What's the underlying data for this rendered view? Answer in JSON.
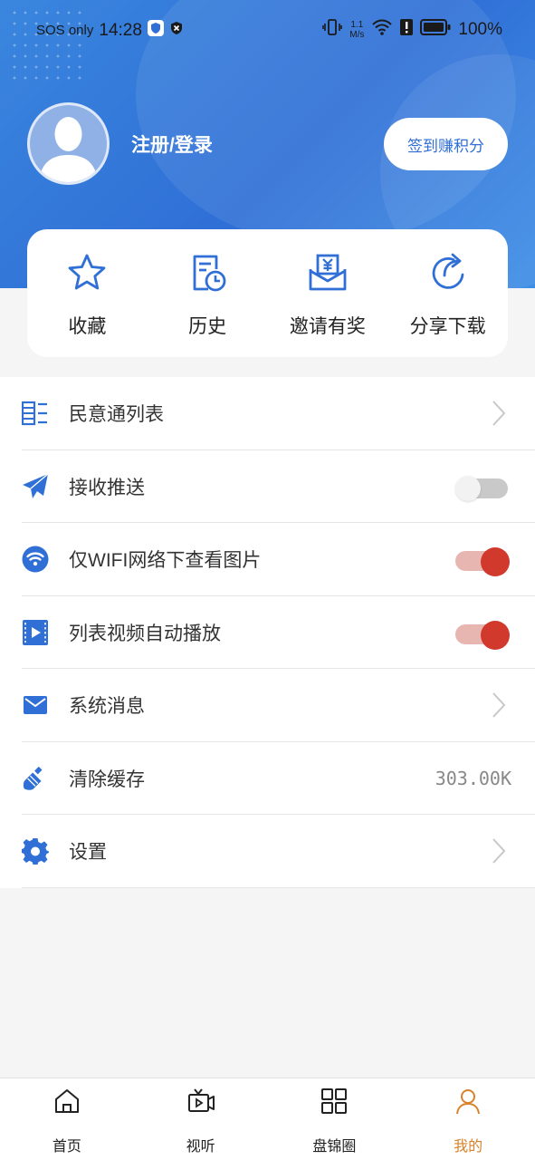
{
  "status_bar": {
    "carrier": "SOS only",
    "time": "14:28",
    "speed_value": "1.1",
    "speed_unit": "M/s",
    "battery": "100%"
  },
  "profile": {
    "login_label": "注册/登录",
    "checkin_button": "签到赚积分"
  },
  "quick_actions": [
    {
      "label": "收藏",
      "icon": "star-icon"
    },
    {
      "label": "历史",
      "icon": "history-icon"
    },
    {
      "label": "邀请有奖",
      "icon": "invite-reward-icon"
    },
    {
      "label": "分享下载",
      "icon": "share-icon"
    }
  ],
  "menu": [
    {
      "label": "民意通列表",
      "icon": "list-icon",
      "control": "chevron"
    },
    {
      "label": "接收推送",
      "icon": "paper-plane-icon",
      "control": "toggle",
      "on": false
    },
    {
      "label": "仅WIFI网络下查看图片",
      "icon": "wifi-icon",
      "control": "toggle",
      "on": true
    },
    {
      "label": "列表视频自动播放",
      "icon": "video-icon",
      "control": "toggle",
      "on": true
    },
    {
      "label": "系统消息",
      "icon": "mail-icon",
      "control": "chevron"
    },
    {
      "label": "清除缓存",
      "icon": "broom-icon",
      "control": "value",
      "value": "303.00K"
    },
    {
      "label": "设置",
      "icon": "gear-icon",
      "control": "chevron"
    }
  ],
  "tabbar": [
    {
      "label": "首页",
      "icon": "home-icon",
      "active": false
    },
    {
      "label": "视听",
      "icon": "tv-icon",
      "active": false
    },
    {
      "label": "盘锦圈",
      "icon": "grid-icon",
      "active": false
    },
    {
      "label": "我的",
      "icon": "person-icon",
      "active": true
    }
  ],
  "colors": {
    "brand_blue": "#2f6fd6",
    "toggle_on": "#d0392b",
    "tab_active": "#d9822b"
  }
}
